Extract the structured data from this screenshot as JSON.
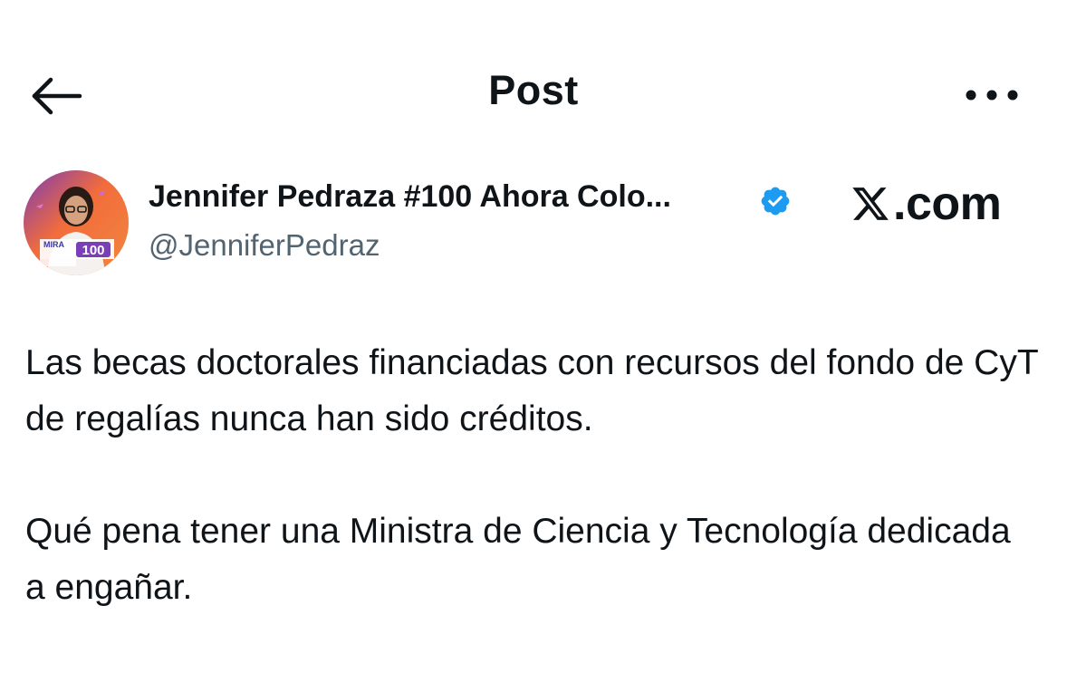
{
  "header": {
    "title": "Post",
    "back_icon": "arrow-left-icon",
    "more_icon": "ellipsis-horizontal-icon"
  },
  "author": {
    "name": "Jennifer Pedraza #100 Ahora Colo...",
    "handle": "@JenniferPedraz",
    "verified": true,
    "verified_color": "#1d9bf0",
    "avatar_badge_left": "MIRA",
    "avatar_badge_number": "100"
  },
  "watermark": {
    "text": ".com",
    "logo_icon": "x-logo-icon"
  },
  "post": {
    "paragraphs": [
      "Las becas doctorales financiadas con recursos del fondo de CyT de regalías nunca han sido créditos.",
      "Qué pena tener una Ministra de Ciencia y Tecnología dedicada a engañar."
    ]
  },
  "colors": {
    "text_primary": "#0f1419",
    "text_secondary": "#536471",
    "avatar_bg": "#f26c3c",
    "avatar_badge_purple": "#7a3fb6"
  }
}
